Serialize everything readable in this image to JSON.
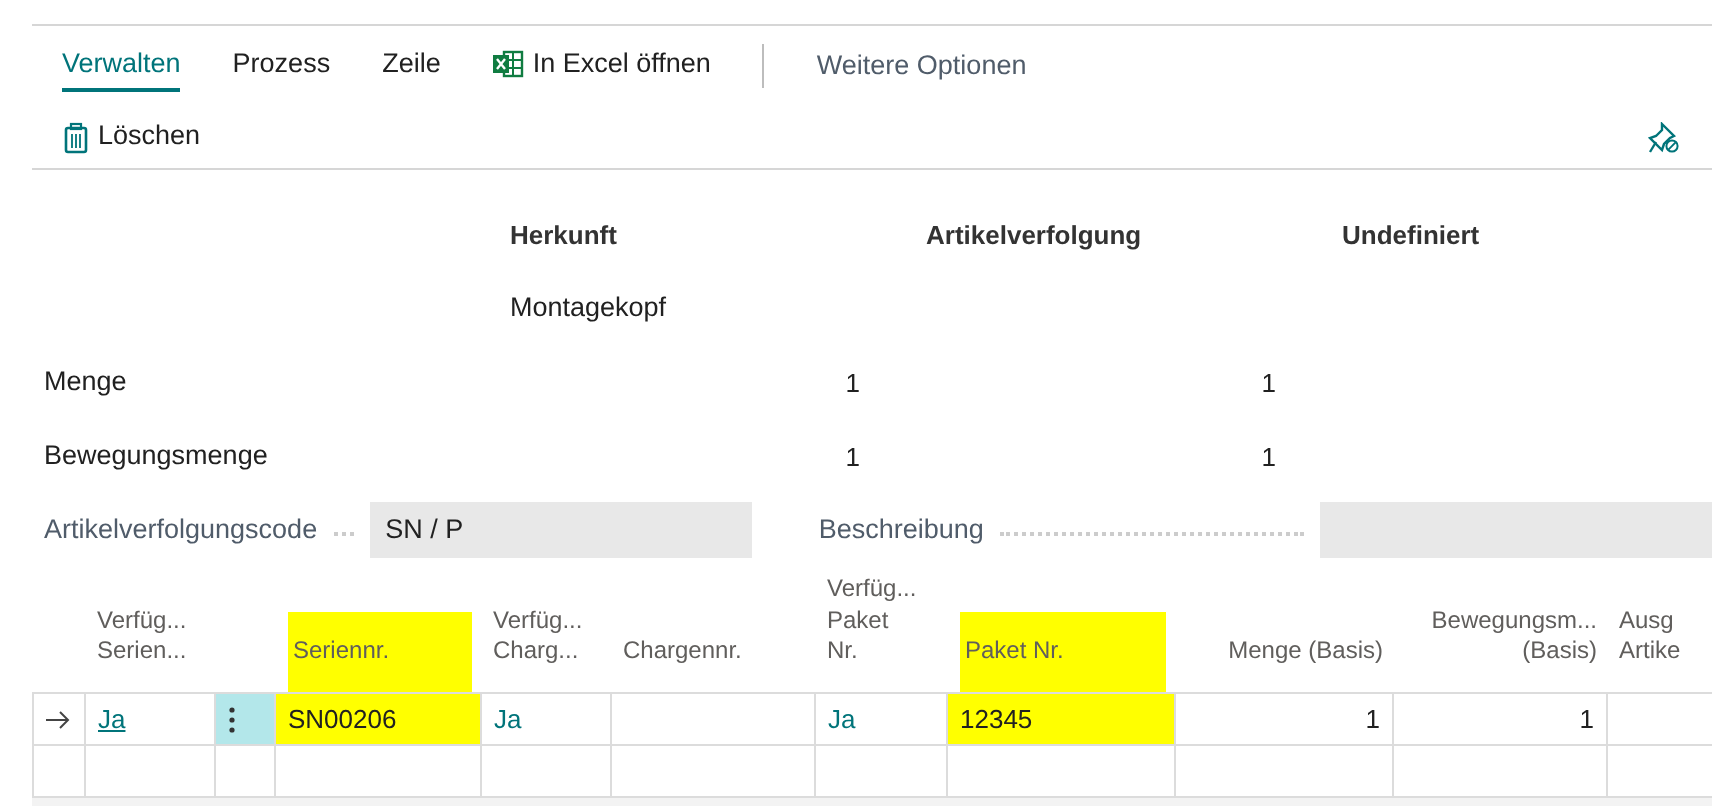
{
  "action_tabs": [
    {
      "label": "Verwalten",
      "selected": true
    },
    {
      "label": "Prozess",
      "selected": false
    },
    {
      "label": "Zeile",
      "selected": false
    },
    {
      "label": "In Excel öffnen",
      "selected": false,
      "kind": "excel"
    }
  ],
  "more_options": "Weitere Optionen",
  "actions": [
    {
      "label": "Löschen",
      "kind": "delete"
    }
  ],
  "summary": {
    "columns": [
      "Herkunft",
      "Artikelverfolgung",
      "Undefiniert"
    ],
    "origin_name": "Montagekopf",
    "rows": [
      {
        "label": "Menge",
        "values": [
          "1",
          "1"
        ]
      },
      {
        "label": "Bewegungsmenge",
        "values": [
          "1",
          "1"
        ]
      }
    ]
  },
  "fields": [
    {
      "label": "Artikelverfolgungscode",
      "value": "SN / P"
    },
    {
      "label": "Beschreibung"
    }
  ],
  "table": {
    "columns": [
      {
        "lines": [
          "Verfüg...",
          "Serien..."
        ],
        "highlighted": false,
        "kind": "text"
      },
      {
        "kind": "menu"
      },
      {
        "lines": [
          "Seriennr."
        ],
        "highlighted": true,
        "kind": "text"
      },
      {
        "lines": [
          "Verfüg...",
          "Charg..."
        ],
        "highlighted": false,
        "kind": "text"
      },
      {
        "lines": [
          "Chargennr."
        ],
        "highlighted": false,
        "kind": "text"
      },
      {
        "lines": [
          "Verfüg...",
          "Paket",
          "Nr."
        ],
        "highlighted": false,
        "kind": "text"
      },
      {
        "lines": [
          "Paket Nr."
        ],
        "highlighted": true,
        "kind": "text"
      },
      {
        "lines": [
          "Menge (Basis)"
        ],
        "highlighted": false,
        "kind": "number"
      },
      {
        "lines": [
          "Bewegungsm...",
          "(Basis)"
        ],
        "highlighted": false,
        "kind": "number"
      },
      {
        "lines": [
          "Ausg",
          "Artike"
        ],
        "highlighted": false,
        "kind": "text"
      }
    ],
    "rows": [
      {
        "current": true,
        "cells": [
          {
            "text": "Ja",
            "kind": "link"
          },
          {
            "kind": "menu"
          },
          {
            "text": "SN00206",
            "highlighted": true
          },
          {
            "text": "Ja",
            "kind": "flag"
          },
          null,
          {
            "text": "Ja",
            "kind": "flag"
          },
          {
            "text": "12345",
            "highlighted": true
          },
          {
            "text": "1"
          },
          {
            "text": "1"
          },
          null
        ]
      },
      {
        "current": false
      }
    ]
  }
}
